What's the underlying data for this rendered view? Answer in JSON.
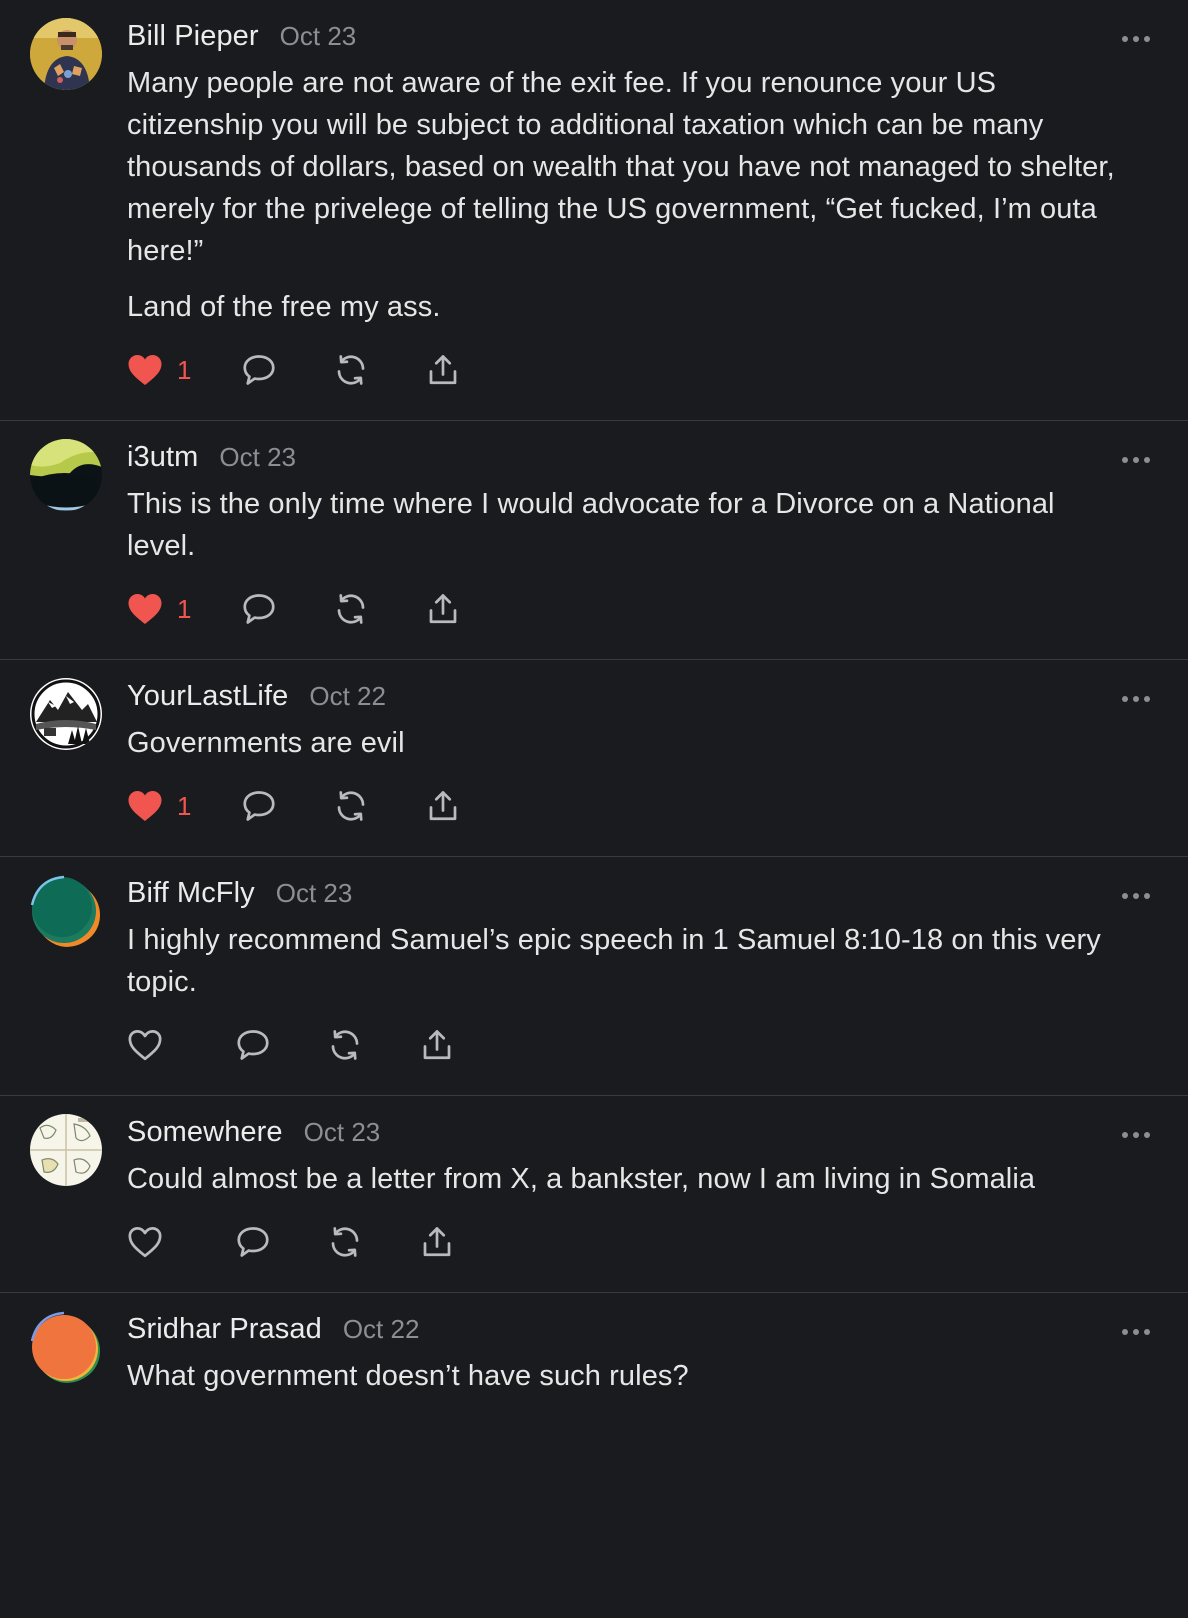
{
  "comments": [
    {
      "author": "Bill Pieper",
      "date": "Oct 23",
      "paragraphs": [
        "Many people are not aware of the exit fee. If you renounce your US citizenship you will be subject to additional taxation which can be many thousands of dollars, based on wealth that you have not managed to shelter, merely for the privelege of telling the US government, “Get fucked, I’m outa here!”",
        "Land of the free my ass."
      ],
      "like_count": "1",
      "liked": true
    },
    {
      "author": "i3utm",
      "date": "Oct 23",
      "paragraphs": [
        "This is the only time where I would advocate for a Divorce on a National level."
      ],
      "like_count": "1",
      "liked": true
    },
    {
      "author": "YourLastLife",
      "date": "Oct 22",
      "paragraphs": [
        "Governments are evil"
      ],
      "like_count": "1",
      "liked": true
    },
    {
      "author": "Biff McFly",
      "date": "Oct 23",
      "paragraphs": [
        "I highly recommend Samuel’s epic speech in 1 Samuel 8:10-18 on this very topic."
      ],
      "like_count": "",
      "liked": false
    },
    {
      "author": "Somewhere",
      "date": "Oct 23",
      "paragraphs": [
        "Could almost be a letter from X, a bankster, now I am living in Somalia"
      ],
      "like_count": "",
      "liked": false
    },
    {
      "author": "Sridhar Prasad",
      "date": "Oct 22",
      "paragraphs": [
        "What government doesn’t have such rules?"
      ],
      "like_count": "",
      "liked": false
    }
  ],
  "colors": {
    "background": "#1a1b1e",
    "like_active": "#f0564f",
    "icon": "#b9babd",
    "muted_text": "#8d8e93"
  },
  "icons": {
    "like": "heart-icon",
    "reply": "speech-bubble-icon",
    "restack": "restack-arrows-icon",
    "share": "share-upload-icon",
    "more": "ellipsis-icon"
  }
}
